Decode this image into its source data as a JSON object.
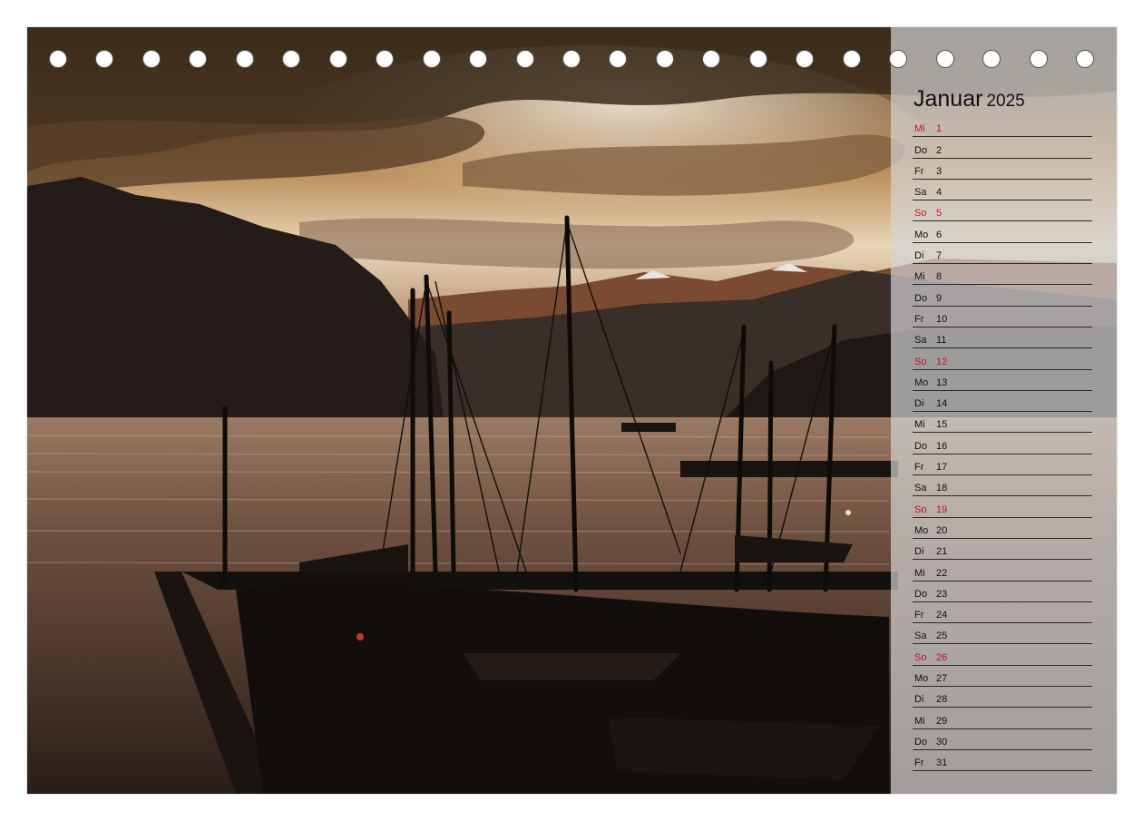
{
  "calendar": {
    "month": "Januar",
    "year": "2025",
    "days": [
      {
        "wd": "Mi",
        "d": "1",
        "sunday": false,
        "highlight": true
      },
      {
        "wd": "Do",
        "d": "2",
        "sunday": false
      },
      {
        "wd": "Fr",
        "d": "3",
        "sunday": false
      },
      {
        "wd": "Sa",
        "d": "4",
        "sunday": false
      },
      {
        "wd": "So",
        "d": "5",
        "sunday": true
      },
      {
        "wd": "Mo",
        "d": "6",
        "sunday": false
      },
      {
        "wd": "Di",
        "d": "7",
        "sunday": false
      },
      {
        "wd": "Mi",
        "d": "8",
        "sunday": false
      },
      {
        "wd": "Do",
        "d": "9",
        "sunday": false
      },
      {
        "wd": "Fr",
        "d": "10",
        "sunday": false
      },
      {
        "wd": "Sa",
        "d": "11",
        "sunday": false
      },
      {
        "wd": "So",
        "d": "12",
        "sunday": true
      },
      {
        "wd": "Mo",
        "d": "13",
        "sunday": false
      },
      {
        "wd": "Di",
        "d": "14",
        "sunday": false
      },
      {
        "wd": "Mi",
        "d": "15",
        "sunday": false
      },
      {
        "wd": "Do",
        "d": "16",
        "sunday": false
      },
      {
        "wd": "Fr",
        "d": "17",
        "sunday": false
      },
      {
        "wd": "Sa",
        "d": "18",
        "sunday": false
      },
      {
        "wd": "So",
        "d": "19",
        "sunday": true
      },
      {
        "wd": "Mo",
        "d": "20",
        "sunday": false
      },
      {
        "wd": "Di",
        "d": "21",
        "sunday": false
      },
      {
        "wd": "Mi",
        "d": "22",
        "sunday": false
      },
      {
        "wd": "Do",
        "d": "23",
        "sunday": false
      },
      {
        "wd": "Fr",
        "d": "24",
        "sunday": false
      },
      {
        "wd": "Sa",
        "d": "25",
        "sunday": false
      },
      {
        "wd": "So",
        "d": "26",
        "sunday": true
      },
      {
        "wd": "Mo",
        "d": "27",
        "sunday": false
      },
      {
        "wd": "Di",
        "d": "28",
        "sunday": false
      },
      {
        "wd": "Mi",
        "d": "29",
        "sunday": false
      },
      {
        "wd": "Do",
        "d": "30",
        "sunday": false
      },
      {
        "wd": "Fr",
        "d": "31",
        "sunday": false
      }
    ]
  },
  "binding": {
    "ring_count": 23
  },
  "colors": {
    "sunday": "#c8102e",
    "text": "#111111",
    "panel": "#d4d4d4"
  }
}
